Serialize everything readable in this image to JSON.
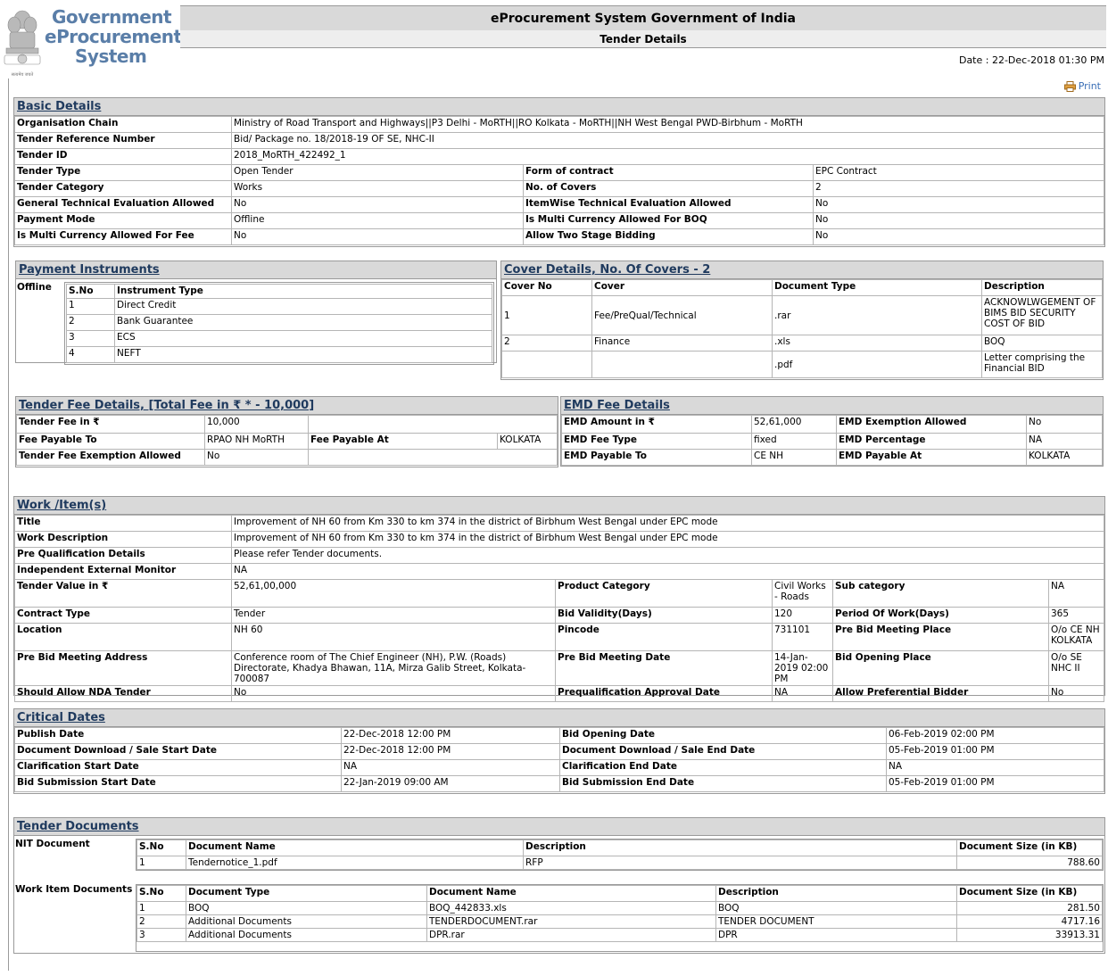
{
  "header": {
    "logo_lines": [
      "Government",
      "eProcurement",
      "System"
    ],
    "system_title": "eProcurement System Government of India",
    "page_title": "Tender Details",
    "date_text": "Date : 22-Dec-2018 01:30 PM",
    "print_label": "Print"
  },
  "basic_details": {
    "title": "Basic Details",
    "organisation_chain_label": "Organisation Chain",
    "organisation_chain": "Ministry of Road Transport and Highways||P3 Delhi - MoRTH||RO Kolkata - MoRTH||NH West Bengal PWD-Birbhum - MoRTH",
    "tender_ref_label": "Tender Reference Number",
    "tender_ref": "Bid/ Package no. 18/2018-19 OF SE, NHC-II",
    "tender_id_label": "Tender ID",
    "tender_id": "2018_MoRTH_422492_1",
    "rows": [
      {
        "l1": "Tender Type",
        "v1": "Open Tender",
        "l2": "Form of contract",
        "v2": "EPC Contract"
      },
      {
        "l1": "Tender Category",
        "v1": "Works",
        "l2": "No. of Covers",
        "v2": "2"
      },
      {
        "l1": "General Technical Evaluation Allowed",
        "v1": "No",
        "l2": "ItemWise Technical Evaluation Allowed",
        "v2": "No"
      },
      {
        "l1": "Payment Mode",
        "v1": "Offline",
        "l2": "Is Multi Currency Allowed For BOQ",
        "v2": "No"
      },
      {
        "l1": "Is Multi Currency Allowed For Fee",
        "v1": "No",
        "l2": "Allow Two Stage Bidding",
        "v2": "No"
      }
    ]
  },
  "payment_instruments": {
    "title": "Payment Instruments",
    "mode": "Offline",
    "col_sno": "S.No",
    "col_type": "Instrument Type",
    "items": [
      {
        "sno": "1",
        "type": "Direct Credit"
      },
      {
        "sno": "2",
        "type": "Bank Guarantee"
      },
      {
        "sno": "3",
        "type": "ECS"
      },
      {
        "sno": "4",
        "type": "NEFT"
      }
    ]
  },
  "cover_details": {
    "title": "Cover Details, No. Of Covers - 2",
    "col_cover_no": "Cover No",
    "col_cover": "Cover",
    "col_doc_type": "Document Type",
    "col_desc": "Description",
    "rows": [
      {
        "no": "1",
        "cover": "Fee/PreQual/Technical",
        "doc": ".rar",
        "desc": "ACKNOWLWGEMENT OF BIMS BID SECURITY COST OF BID"
      },
      {
        "no": "2",
        "cover": "Finance",
        "doc": ".xls",
        "desc": "BOQ"
      },
      {
        "no": "",
        "cover": "",
        "doc": ".pdf",
        "desc": "Letter comprising the Financial BID"
      }
    ]
  },
  "tender_fee": {
    "title": "Tender Fee Details, [Total Fee in ₹ * - 10,000]",
    "fee_label": "Tender Fee in ₹",
    "fee_value": "10,000",
    "payable_to_label": "Fee Payable To",
    "payable_to": "RPAO NH MoRTH",
    "payable_at_label": "Fee Payable At",
    "payable_at": "KOLKATA",
    "exemption_label": "Tender Fee Exemption Allowed",
    "exemption": "No"
  },
  "emd_fee": {
    "title": "EMD Fee Details",
    "amount_label": "EMD Amount in ₹",
    "amount": "52,61,000",
    "exemption_label": "EMD Exemption Allowed",
    "exemption": "No",
    "fee_type_label": "EMD Fee Type",
    "fee_type": "fixed",
    "percentage_label": "EMD Percentage",
    "percentage": "NA",
    "payable_to_label": "EMD Payable To",
    "payable_to": "CE NH",
    "payable_at_label": "EMD Payable At",
    "payable_at": "KOLKATA"
  },
  "work_items": {
    "title": "Work /Item(s)",
    "title_label": "Title",
    "title_value": "Improvement of NH 60 from Km 330 to km 374 in the district of Birbhum West Bengal under EPC mode",
    "desc_label": "Work Description",
    "desc_value": "Improvement of NH 60 from Km 330 to km 374 in the district of Birbhum West Bengal under EPC mode",
    "preq_label": "Pre Qualification Details",
    "preq_value": "Please refer Tender documents.",
    "iem_label": "Independent External Monitor",
    "iem_value": "NA",
    "rows": [
      {
        "l1": "Tender Value in ₹",
        "v1": "52,61,00,000",
        "l2": "Product Category",
        "v2": "Civil Works - Roads",
        "l3": "Sub category",
        "v3": "NA"
      },
      {
        "l1": "Contract Type",
        "v1": "Tender",
        "l2": "Bid Validity(Days)",
        "v2": "120",
        "l3": "Period Of Work(Days)",
        "v3": "365"
      },
      {
        "l1": "Location",
        "v1": "NH 60",
        "l2": "Pincode",
        "v2": "731101",
        "l3": "Pre Bid Meeting Place",
        "v3": "O/o CE NH KOLKATA"
      },
      {
        "l1": "Pre Bid Meeting Address",
        "v1": "Conference room of The Chief Engineer (NH), P.W. (Roads) Directorate, Khadya Bhawan, 11A, Mirza Galib Street, Kolkata-700087",
        "l2": "Pre Bid Meeting Date",
        "v2": "14-Jan-2019 02:00 PM",
        "l3": "Bid Opening Place",
        "v3": "O/o SE NHC II"
      },
      {
        "l1": "Should Allow NDA Tender",
        "v1": "No",
        "l2": "Prequalification Approval Date",
        "v2": "NA",
        "l3": "Allow Preferential Bidder",
        "v3": "No"
      }
    ]
  },
  "critical_dates": {
    "title": "Critical Dates",
    "rows": [
      {
        "l1": "Publish Date",
        "v1": "22-Dec-2018 12:00 PM",
        "l2": "Bid Opening Date",
        "v2": "06-Feb-2019 02:00 PM"
      },
      {
        "l1": "Document Download / Sale Start Date",
        "v1": "22-Dec-2018 12:00 PM",
        "l2": "Document Download / Sale End Date",
        "v2": "05-Feb-2019 01:00 PM"
      },
      {
        "l1": "Clarification Start Date",
        "v1": "NA",
        "l2": "Clarification End Date",
        "v2": "NA"
      },
      {
        "l1": "Bid Submission Start Date",
        "v1": "22-Jan-2019 09:00 AM",
        "l2": "Bid Submission End Date",
        "v2": "05-Feb-2019 01:00 PM"
      }
    ]
  },
  "tender_documents": {
    "title": "Tender Documents",
    "nit_label": "NIT Document",
    "nit_headers": {
      "sno": "S.No",
      "name": "Document Name",
      "desc": "Description",
      "size": "Document Size (in KB)"
    },
    "nit_rows": [
      {
        "sno": "1",
        "name": "Tendernotice_1.pdf",
        "desc": "RFP",
        "size": "788.60"
      }
    ],
    "work_label": "Work Item Documents",
    "work_headers": {
      "sno": "S.No",
      "type": "Document Type",
      "name": "Document Name",
      "desc": "Description",
      "size": "Document Size (in KB)"
    },
    "work_rows": [
      {
        "sno": "1",
        "type": "BOQ",
        "name": "BOQ_442833.xls",
        "desc": "BOQ",
        "size": "281.50"
      },
      {
        "sno": "2",
        "type": "Additional Documents",
        "name": "TENDERDOCUMENT.rar",
        "desc": "TENDER DOCUMENT",
        "size": "4717.16"
      },
      {
        "sno": "3",
        "type": "Additional Documents",
        "name": "DPR.rar",
        "desc": "DPR",
        "size": "33913.31"
      }
    ]
  }
}
